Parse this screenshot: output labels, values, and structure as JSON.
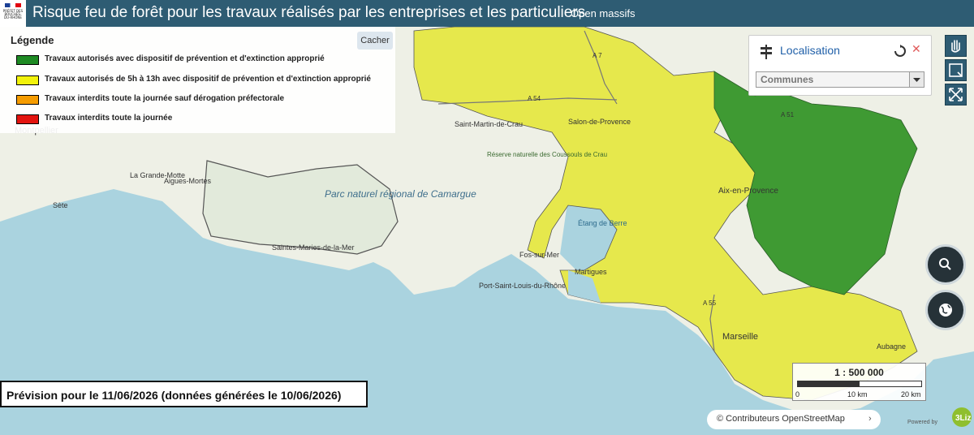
{
  "header": {
    "title": "Risque feu de forêt pour les travaux réalisés par les entreprises et les particuliers",
    "open_massifs": "Open massifs",
    "logo_text": "PRÉFET DES BOUCHES-DU-RHÔNE",
    "bg_color": "#2e5c73"
  },
  "legend": {
    "title": "Légende",
    "hide_label": "Cacher",
    "items": [
      {
        "label": "Travaux autorisés avec dispositif de prévention et d'extinction approprié",
        "color": "#1e8a23"
      },
      {
        "label": "Travaux autorisés de 5h à 13h avec dispositif de prévention et d'extinction approprié",
        "color": "#f2f20a"
      },
      {
        "label": "Travaux interdits toute la journée sauf dérogation préfectorale",
        "color": "#f59c00"
      },
      {
        "label": "Travaux interdits toute la journée",
        "color": "#e3140f"
      }
    ]
  },
  "localisation": {
    "title": "Localisation",
    "select_value": "Communes"
  },
  "map_labels": {
    "montpellier": "Montpellier",
    "sete": "Sète",
    "la_grande_motte": "La Grande-Motte",
    "aigues_mortes": "Aigues-Mortes",
    "parc_camargue": "Parc naturel régional de Camargue",
    "saintes_maries": "Saintes-Maries-de-la-Mer",
    "saint_martin_de_crau": "Saint-Martin-de-Crau",
    "salon_de_provence": "Salon-de-Provence",
    "etang_de_berre": "Étang de Berre",
    "aix_en_provence": "Aix-en-Provence",
    "marseille": "Marseille",
    "fos_sur_mer": "Fos-sur-Mer",
    "port_saint_louis": "Port-Saint-Louis-du-Rhône",
    "martigues": "Martigues",
    "aubagne": "Aubagne",
    "a7": "A 7",
    "a54": "A 54",
    "a55": "A 55",
    "a51": "A 51",
    "coussouls": "Réserve naturelle des Coussouls de Crau"
  },
  "scale": {
    "ratio": "1 : 500 000",
    "ticks": [
      "0",
      "10 km",
      "20 km"
    ]
  },
  "forecast": "Prévision pour le 11/06/2026 (données générées le 10/06/2026)",
  "attribution": {
    "text": "© Contributeurs OpenStreetMap",
    "powered_by": "Powered by",
    "brand": "3Liz"
  },
  "colors": {
    "sea": "#aad3df",
    "land": "#eef0e6",
    "green_zone": "#3f9a33",
    "yellow_zone": "#e6e84c"
  }
}
